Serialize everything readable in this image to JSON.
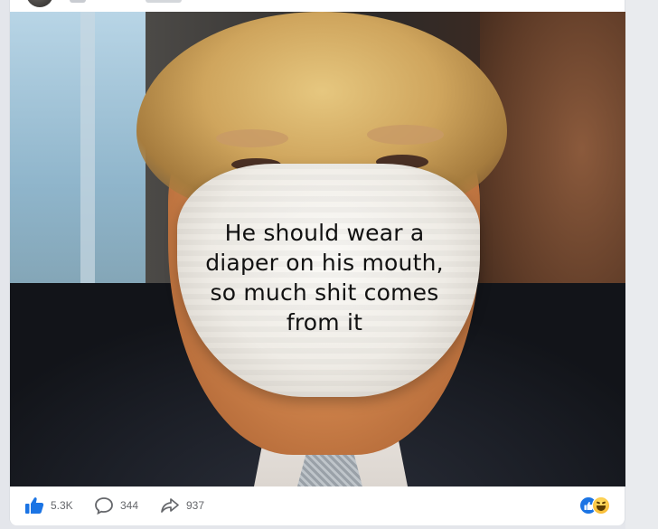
{
  "post": {
    "image_caption_text": "He should wear a diaper on his mouth, so much shit comes from it",
    "caption_lines": [
      "He should wear a",
      "diaper on his mouth,",
      "so much shit comes",
      "from it"
    ]
  },
  "actions": {
    "like_count": "5.3K",
    "comment_count": "344",
    "share_count": "937"
  },
  "icons": {
    "like": "thumbs-up-icon",
    "comment": "comment-bubble-icon",
    "share": "share-arrow-icon",
    "reaction_like": "like-reaction-icon",
    "reaction_haha": "haha-reaction-icon"
  },
  "colors": {
    "like_blue": "#1b74e4",
    "muted_text": "#65676b",
    "haha_yellow": "#f7b125"
  }
}
